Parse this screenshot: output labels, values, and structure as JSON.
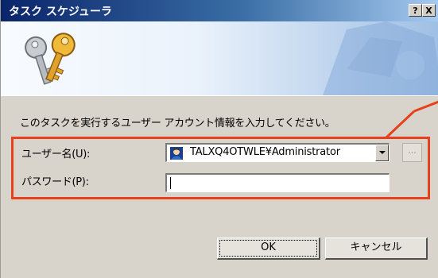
{
  "window": {
    "title": "タスク スケジューラ",
    "help_button": "?",
    "close_button": "X"
  },
  "instruction": "このタスクを実行するユーザー アカウント情報を入力してください。",
  "form": {
    "username_label": "ユーザー名(U):",
    "username_value": "TALXQ4OTWLE¥Administrator",
    "browse_button": "...",
    "password_label": "パスワード(P):",
    "password_value": ""
  },
  "buttons": {
    "ok": "OK",
    "cancel": "キャンセル"
  },
  "colors": {
    "highlight": "#e8401c",
    "titlebar": "#0a246a",
    "dialog_bg": "#d8d4cb"
  },
  "icons": {
    "banner": "keys-icon",
    "user": "user-icon"
  }
}
